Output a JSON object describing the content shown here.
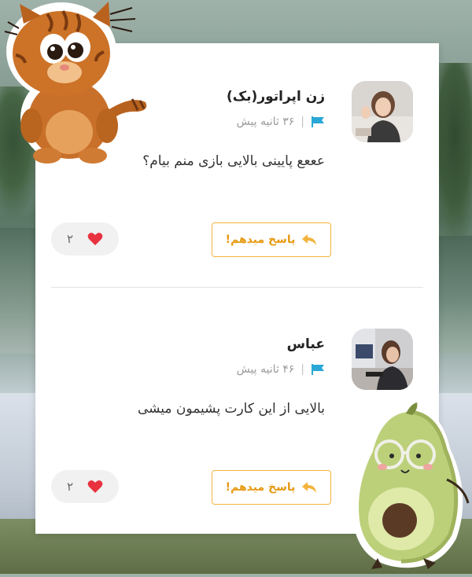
{
  "comments": [
    {
      "username": "زن اپراتور(بک)",
      "time": "۳۶ ثانیه پیش",
      "separator": "|",
      "message": "عععع پایینی بالایی بازی منم بیام؟",
      "reply_label": "پاسخ میدهم!",
      "like_count": "۲"
    },
    {
      "username": "عباس",
      "time": "۴۶ ثانیه پیش",
      "separator": "|",
      "message": "بالایی از این کارت پشیمون میشی",
      "reply_label": "پاسخ میدهم!",
      "like_count": "۲"
    }
  ],
  "icons": {
    "flag": "flag-icon",
    "reply": "reply-arrow-icon",
    "heart": "heart-icon"
  },
  "colors": {
    "accent": "#f3b33d",
    "flag": "#2aa7d6",
    "heart": "#e8323f"
  }
}
